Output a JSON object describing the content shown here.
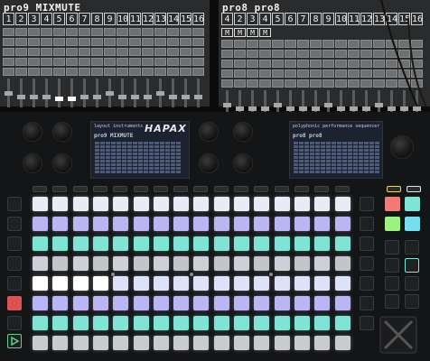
{
  "left_screen": {
    "title": "pro9 MIXMUTE",
    "numbers": [
      "1",
      "2",
      "3",
      "4",
      "5",
      "6",
      "7",
      "8",
      "9",
      "10",
      "11",
      "12",
      "13",
      "14",
      "15",
      "16"
    ]
  },
  "right_screen": {
    "title": "pro8 pro8",
    "numbers": [
      "4",
      "2",
      "3",
      "4",
      "5",
      "6",
      "7",
      "8",
      "9",
      "10",
      "11",
      "12",
      "13",
      "14",
      "15",
      "16"
    ],
    "mute_label": "M"
  },
  "device": {
    "brand": "HAPAX",
    "left_lcd_header": "layout instruments",
    "left_lcd_title": "pro9 MIXMUTE",
    "right_lcd_header": "polyphonic performance sequencer",
    "right_lcd_title": "pro8 pro8"
  },
  "colors": {
    "pad_white": "#e9ecf6",
    "pad_lavender": "#b9b6f3",
    "pad_teal": "#7fe4d6",
    "pad_grey": "#c9cbd1",
    "pad_red": "#f07c78",
    "pad_green": "#9bf27e",
    "pad_cyan": "#73dff0",
    "play_green": "#63d08a",
    "record_red": "#d8534e"
  }
}
